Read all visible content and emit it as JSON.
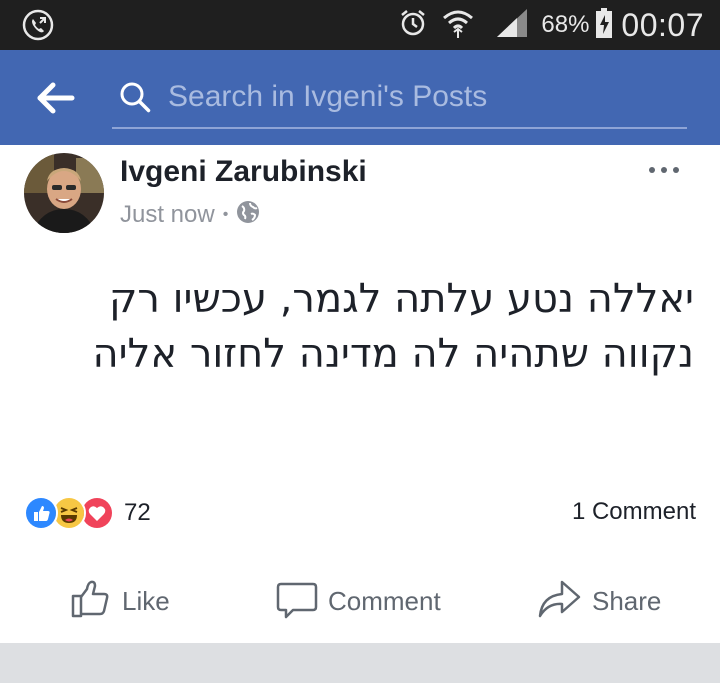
{
  "status_bar": {
    "left_icon": "phone-call-icon",
    "icons": [
      "alarm-icon",
      "wifi-icon",
      "signal-icon",
      "battery-charging-icon"
    ],
    "battery": "68%",
    "time": "00:07"
  },
  "search": {
    "back_icon": "back-arrow-icon",
    "placeholder": "Search in Ivgeni's Posts"
  },
  "post": {
    "author": "Ivgeni Zarubinski",
    "timestamp": "Just now",
    "privacy_icon": "globe-icon",
    "text": "יאללה נטע עלתה לגמר, עכשיו רק נקווה שתהיה לה מדינה לחזור אליה",
    "reactions": {
      "types": [
        "like",
        "haha",
        "love"
      ],
      "count": "72"
    },
    "comments": "1 Comment"
  },
  "actions": {
    "like": "Like",
    "comment": "Comment",
    "share": "Share"
  },
  "colors": {
    "brand": "#4267b2",
    "status_bar": "#1f1f1f",
    "like_blue": "#2d88ff",
    "haha_yellow": "#f7c744",
    "love_red": "#f0435a"
  }
}
